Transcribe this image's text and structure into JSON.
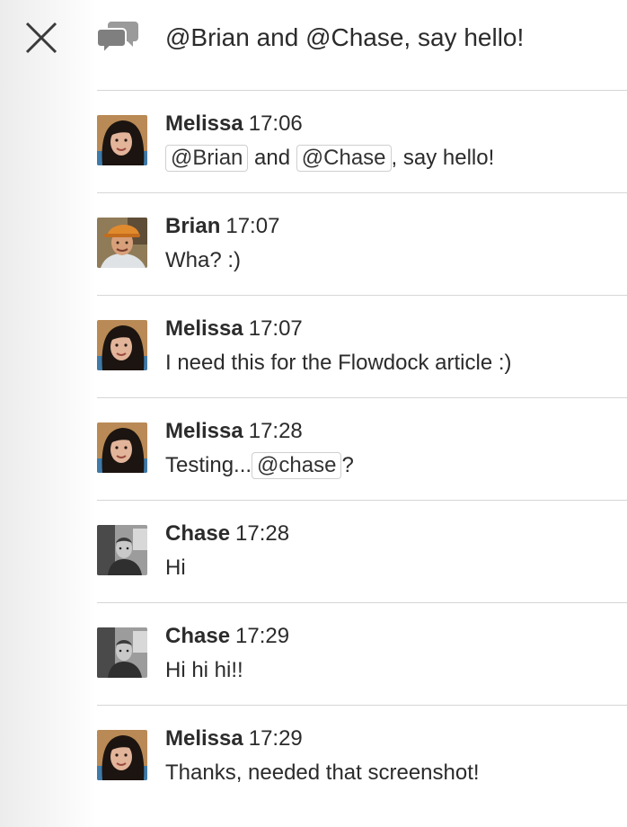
{
  "thread": {
    "title": "@Brian and @Chase, say hello!"
  },
  "icons": {
    "close": "close-icon",
    "thread": "chat-bubbles-icon"
  },
  "messages": [
    {
      "author": "Melissa",
      "time": "17:06",
      "avatar": "melissa",
      "body": [
        {
          "m": "@Brian"
        },
        {
          "t": " and "
        },
        {
          "m": "@Chase"
        },
        {
          "t": ", say hello!"
        }
      ]
    },
    {
      "author": "Brian",
      "time": "17:07",
      "avatar": "brian",
      "body": [
        {
          "t": "Wha? :)"
        }
      ]
    },
    {
      "author": "Melissa",
      "time": "17:07",
      "avatar": "melissa",
      "body": [
        {
          "t": "I need this for the Flowdock article :)"
        }
      ]
    },
    {
      "author": "Melissa",
      "time": "17:28",
      "avatar": "melissa",
      "body": [
        {
          "t": "Testing..."
        },
        {
          "m": "@chase"
        },
        {
          "t": "?"
        }
      ]
    },
    {
      "author": "Chase",
      "time": "17:28",
      "avatar": "chase",
      "body": [
        {
          "t": "Hi"
        }
      ]
    },
    {
      "author": "Chase",
      "time": "17:29",
      "avatar": "chase",
      "body": [
        {
          "t": "Hi hi hi!!"
        }
      ]
    },
    {
      "author": "Melissa",
      "time": "17:29",
      "avatar": "melissa",
      "body": [
        {
          "t": "Thanks, needed that screenshot!"
        }
      ]
    }
  ]
}
